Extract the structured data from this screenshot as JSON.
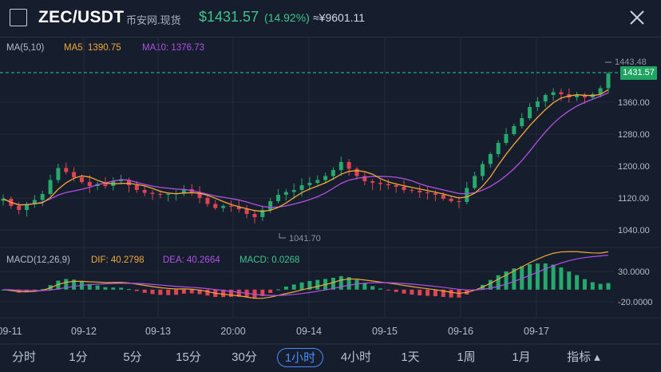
{
  "header": {
    "pair": "ZEC/USDT",
    "source": "币安网.现货",
    "price": "$1431.57",
    "change_pct": "(14.92%)",
    "cny_price": "≈¥9601.11"
  },
  "ma_legend": {
    "label": "MA(5,10)",
    "ma5": "MA5: 1390.75",
    "ma10": "MA10: 1376.73"
  },
  "macd_legend": {
    "label": "MACD(12,26,9)",
    "dif": "DIF: 40.2798",
    "dea": "DEA: 40.2664",
    "macd": "MACD: 0.0268"
  },
  "price_axis": {
    "ticks": [
      "1360.00",
      "1280.00",
      "1200.00",
      "1120.00",
      "1040.00"
    ],
    "current_price": "1431.57",
    "high_marker": "1443.48",
    "low_marker": "1041.70"
  },
  "macd_axis": {
    "ticks": [
      "30.0000",
      "-20.0000"
    ]
  },
  "time_axis": {
    "labels": [
      "09-11",
      "09-12",
      "09-13",
      "20:00",
      "09-14",
      "09-15",
      "09-16",
      "09-17"
    ]
  },
  "timeframes": [
    {
      "label": "分时",
      "active": false
    },
    {
      "label": "1分",
      "active": false
    },
    {
      "label": "5分",
      "active": false
    },
    {
      "label": "15分",
      "active": false
    },
    {
      "label": "30分",
      "active": false
    },
    {
      "label": "1小时",
      "active": true
    },
    {
      "label": "4小时",
      "active": false
    },
    {
      "label": "1天",
      "active": false
    },
    {
      "label": "1周",
      "active": false
    },
    {
      "label": "1月",
      "active": false
    },
    {
      "label": "指标 ▴",
      "active": false
    }
  ],
  "colors": {
    "up": "#26a96c",
    "down": "#e04452",
    "ma5": "#f0a93b",
    "ma10": "#b152e6",
    "price_line": "#33c7a0",
    "active_tab": "#4a8df8"
  },
  "chart_data": {
    "type": "candlestick",
    "ylim": [
      1000,
      1460
    ],
    "close_series": [
      1118,
      1100,
      1090,
      1105,
      1115,
      1130,
      1165,
      1195,
      1185,
      1172,
      1160,
      1150,
      1155,
      1150,
      1162,
      1165,
      1152,
      1140,
      1133,
      1130,
      1128,
      1130,
      1132,
      1142,
      1135,
      1120,
      1105,
      1095,
      1100,
      1098,
      1092,
      1080,
      1072,
      1090,
      1112,
      1128,
      1135,
      1140,
      1152,
      1158,
      1165,
      1175,
      1190,
      1210,
      1193,
      1175,
      1162,
      1158,
      1155,
      1152,
      1148,
      1140,
      1138,
      1134,
      1132,
      1128,
      1118,
      1112,
      1110,
      1145,
      1175,
      1205,
      1230,
      1258,
      1280,
      1300,
      1320,
      1348,
      1362,
      1378,
      1385,
      1380,
      1372,
      1378,
      1372,
      1380,
      1395,
      1431.57
    ],
    "ma5_value": 1390.75,
    "ma10_value": 1376.73,
    "macd": {
      "dif": 40.2798,
      "dea": 40.2664,
      "macd": 0.0268
    }
  }
}
